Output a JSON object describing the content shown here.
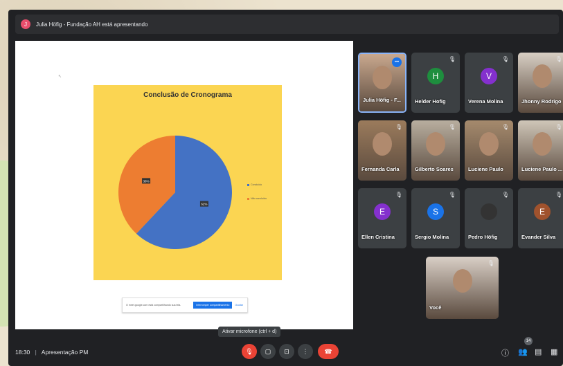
{
  "header": {
    "presenter_initial": "J",
    "presenting_text": "Julia Höfig - Fundação AH está apresentando"
  },
  "slide": {
    "chart_data": {
      "type": "pie",
      "title": "Conclusão de Cronograma",
      "categories": [
        "Concluído",
        "Não concluído"
      ],
      "values": [
        62,
        38
      ],
      "labels": [
        "62%",
        "38%"
      ],
      "colors": [
        "#4472c4",
        "#ed7d31"
      ],
      "legend": "right"
    }
  },
  "share_banner": {
    "text": "O meet.google.com está compartilhando sua tela.",
    "stop_label": "Interromper compartilhamento",
    "hide_label": "Ocultar"
  },
  "participants": [
    {
      "name": "Julia Höfig - F...",
      "type": "video",
      "color": "#c9a88e"
    },
    {
      "name": "Helder Hofig",
      "type": "avatar",
      "initial": "H",
      "color": "#1e8e3e"
    },
    {
      "name": "Verena Molina",
      "type": "avatar",
      "initial": "V",
      "color": "#8430ce"
    },
    {
      "name": "Jhonny Rodrigo",
      "type": "video",
      "color": "#d8cfc4"
    },
    {
      "name": "Fernanda Carla",
      "type": "video",
      "color": "#9b7b5c"
    },
    {
      "name": "Gilberto Soares",
      "type": "video",
      "color": "#b8ae9f"
    },
    {
      "name": "Luciene Paulo",
      "type": "video",
      "color": "#a58a6d"
    },
    {
      "name": "Luciene Paulo ...",
      "type": "video",
      "color": "#cfc6b8"
    },
    {
      "name": "Ellen Cristina",
      "type": "avatar",
      "initial": "E",
      "color": "#8430ce"
    },
    {
      "name": "Sergio Molina",
      "type": "avatar",
      "initial": "S",
      "color": "#1a73e8"
    },
    {
      "name": "Pedro Höfig",
      "type": "avatar",
      "initial": "",
      "color": "#333333"
    },
    {
      "name": "Evander Silva",
      "type": "avatar",
      "initial": "E",
      "color": "#a0522d"
    },
    {
      "name": "Você",
      "type": "video",
      "color": "#d9cfc6"
    }
  ],
  "tooltip": "Ativar microfone (ctrl + d)",
  "bottom": {
    "time": "18:30",
    "separator": "|",
    "meeting_name": "Apresentação PM",
    "participant_count": "14"
  },
  "icons": {
    "mic_off": "🎙",
    "camera": "▢",
    "present": "⊡",
    "more": "⋮",
    "hangup": "☎",
    "info": "ⓘ",
    "people": "👥",
    "chat": "▤",
    "activities": "▦"
  }
}
